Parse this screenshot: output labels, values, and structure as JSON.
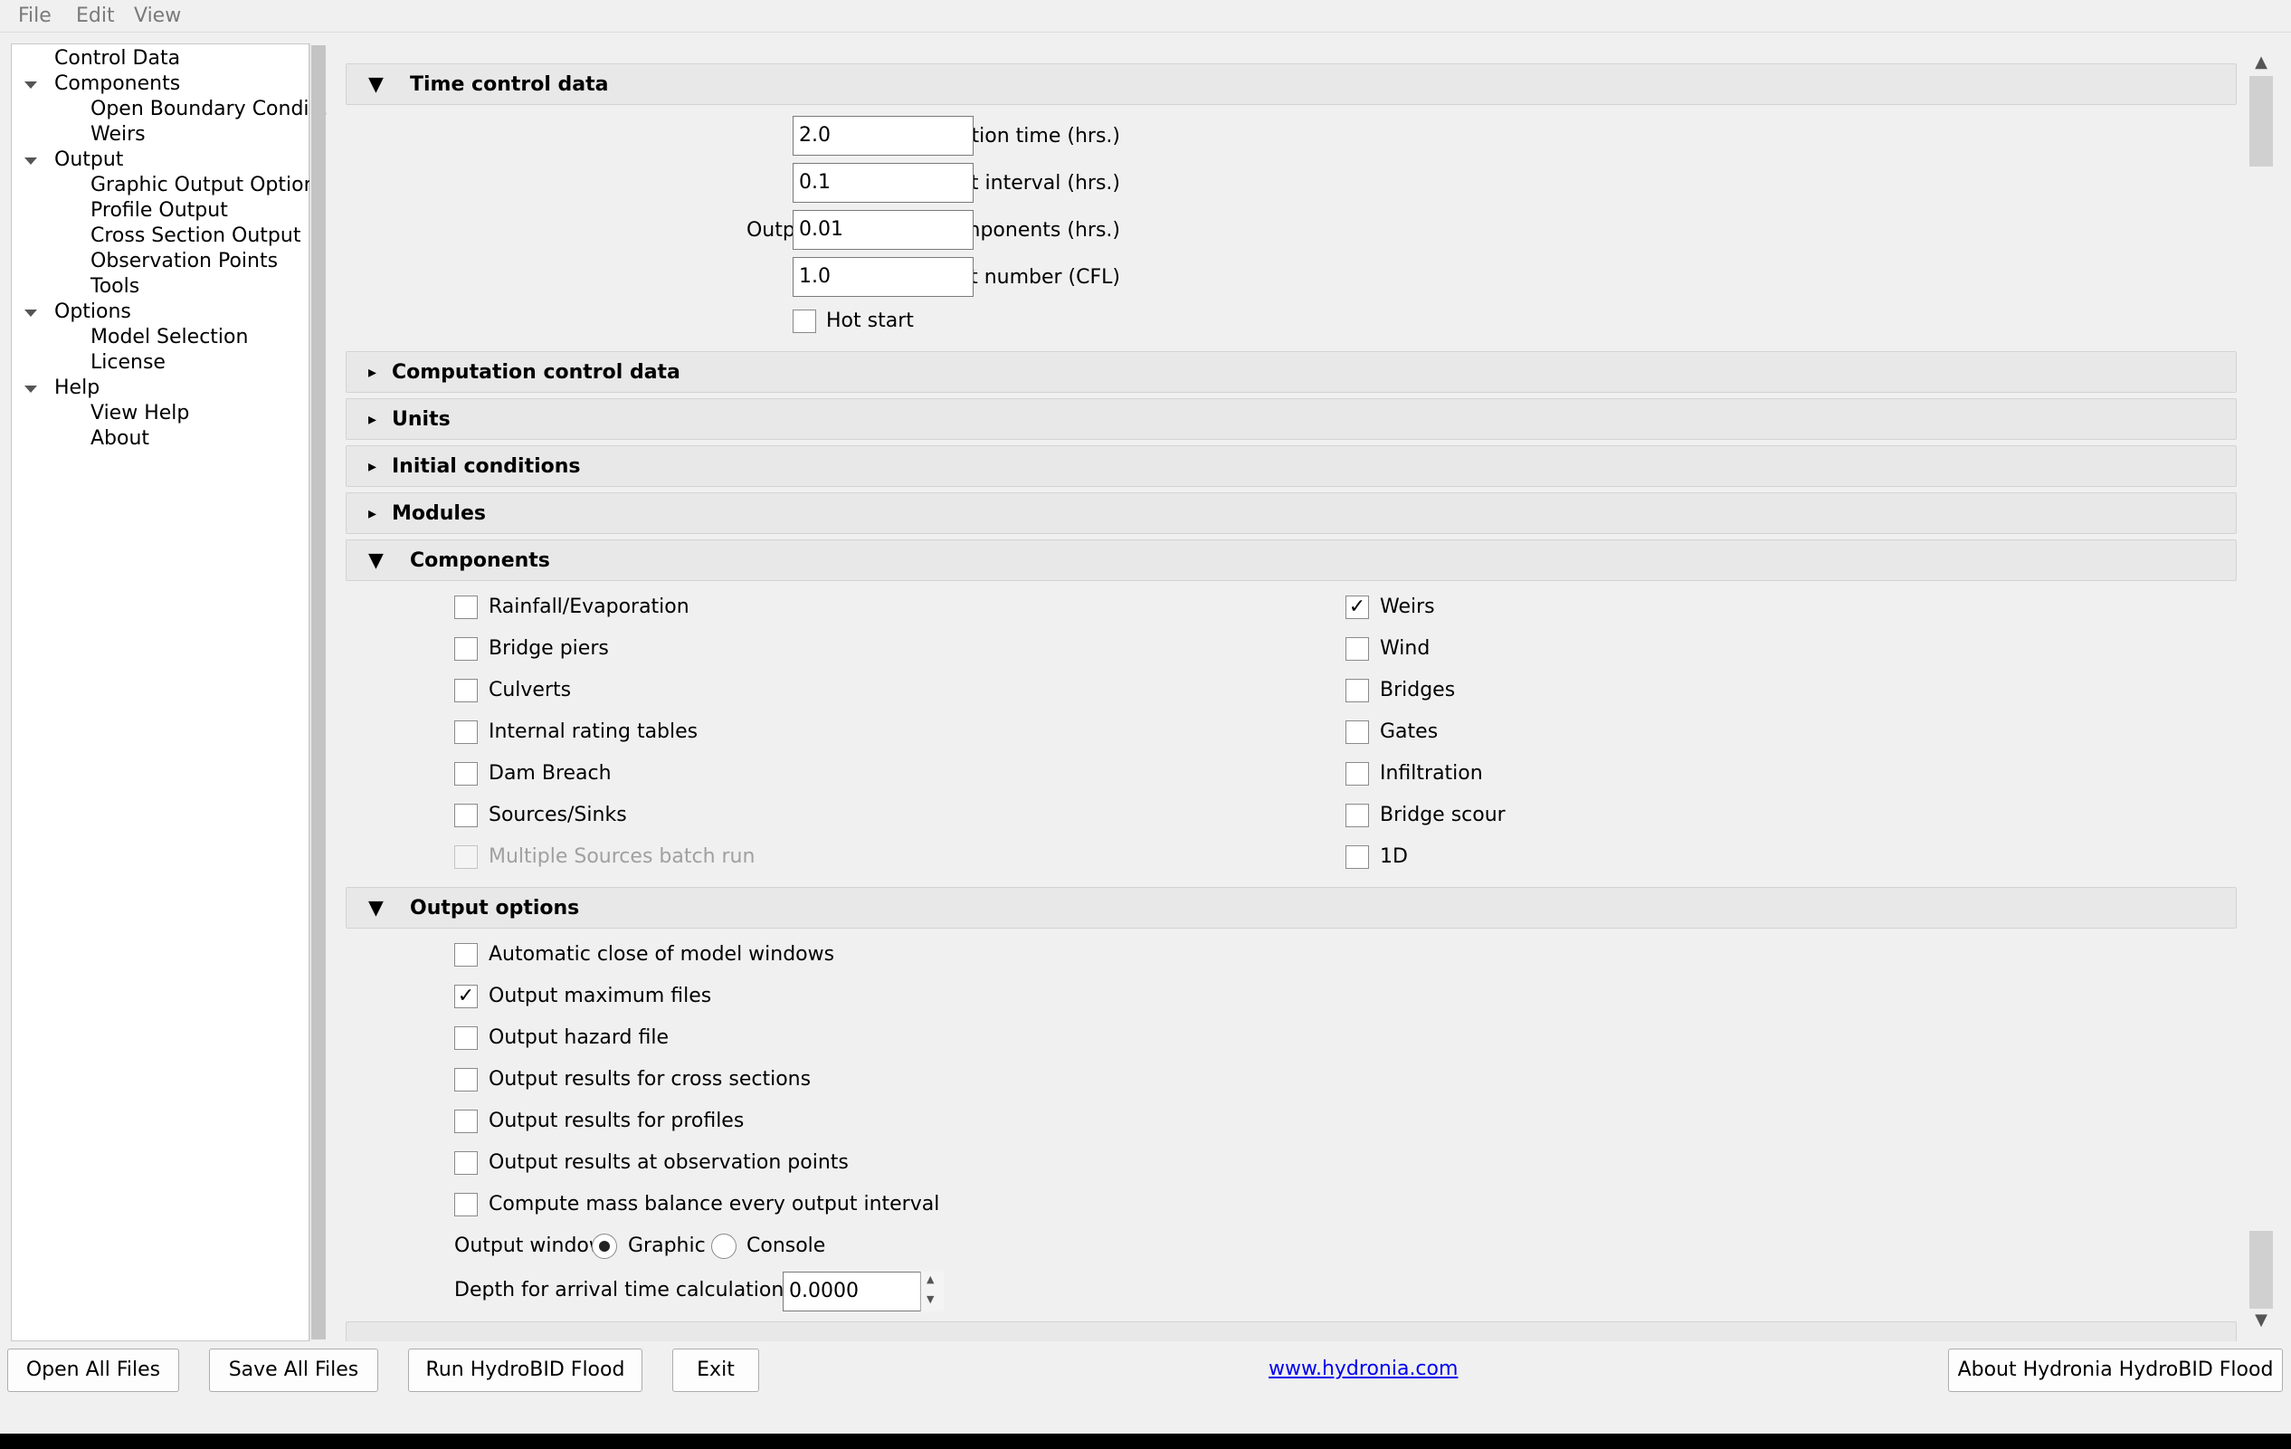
{
  "menu": {
    "file": "File",
    "edit": "Edit",
    "view": "View"
  },
  "sidebar": {
    "items": [
      {
        "label": "Control Data"
      },
      {
        "label": "Components"
      },
      {
        "label": "Open Boundary Condi..."
      },
      {
        "label": "Weirs"
      },
      {
        "label": "Output"
      },
      {
        "label": "Graphic Output Options"
      },
      {
        "label": "Profile Output"
      },
      {
        "label": "Cross Section Output"
      },
      {
        "label": "Observation Points"
      },
      {
        "label": "Tools"
      },
      {
        "label": "Options"
      },
      {
        "label": "Model Selection"
      },
      {
        "label": "License"
      },
      {
        "label": "Help"
      },
      {
        "label": "View Help"
      },
      {
        "label": "About"
      }
    ]
  },
  "sections": {
    "time_control": {
      "title": "Time control data",
      "simulation_time_label": "Simulation time (hrs.)",
      "simulation_time_value": "2.0",
      "output_interval_label": "Output interval (hrs.)",
      "output_interval_value": "0.1",
      "output_interval_components_label": "Output interval for components (hrs.)",
      "output_interval_components_value": "0.01",
      "courant_label": "Courant number (CFL)",
      "courant_value": "1.0",
      "hot_start_label": "Hot start",
      "hot_start_checked": false
    },
    "computation_control": {
      "title": "Computation control data"
    },
    "units": {
      "title": "Units"
    },
    "initial_conditions": {
      "title": "Initial conditions"
    },
    "modules": {
      "title": "Modules"
    },
    "components": {
      "title": "Components",
      "left": [
        {
          "label": "Rainfall/Evaporation",
          "checked": false,
          "enabled": true
        },
        {
          "label": "Bridge piers",
          "checked": false,
          "enabled": true
        },
        {
          "label": "Culverts",
          "checked": false,
          "enabled": true
        },
        {
          "label": "Internal rating tables",
          "checked": false,
          "enabled": true
        },
        {
          "label": "Dam Breach",
          "checked": false,
          "enabled": true
        },
        {
          "label": "Sources/Sinks",
          "checked": false,
          "enabled": true
        },
        {
          "label": "Multiple Sources batch run",
          "checked": false,
          "enabled": false
        }
      ],
      "right": [
        {
          "label": "Weirs",
          "checked": true,
          "enabled": true
        },
        {
          "label": "Wind",
          "checked": false,
          "enabled": true
        },
        {
          "label": "Bridges",
          "checked": false,
          "enabled": true
        },
        {
          "label": "Gates",
          "checked": false,
          "enabled": true
        },
        {
          "label": "Infiltration",
          "checked": false,
          "enabled": true
        },
        {
          "label": "Bridge scour",
          "checked": false,
          "enabled": true
        },
        {
          "label": "1D",
          "checked": false,
          "enabled": true
        }
      ]
    },
    "output_options": {
      "title": "Output options",
      "items": [
        {
          "label": "Automatic close of model windows",
          "checked": false
        },
        {
          "label": "Output maximum files",
          "checked": true
        },
        {
          "label": "Output hazard file",
          "checked": false
        },
        {
          "label": "Output results for cross sections",
          "checked": false
        },
        {
          "label": "Output results for profiles",
          "checked": false
        },
        {
          "label": "Output results at observation points",
          "checked": false
        },
        {
          "label": "Compute mass balance every output interval",
          "checked": false
        }
      ],
      "output_window_label": "Output window",
      "radio_graphic": "Graphic",
      "radio_console": "Console",
      "selected_window": "Graphic",
      "arrival_depth_label": "Depth for arrival time calculation (ft)",
      "arrival_depth_value": "0.0000"
    }
  },
  "checkmark_glyph": "✓",
  "footer": {
    "open_all": "Open All Files",
    "save_all": "Save All Files",
    "run": "Run HydroBID Flood",
    "exit": "Exit",
    "website": "www.hydronia.com",
    "about": "About Hydronia HydroBID Flood"
  },
  "icons": {
    "expanded_arrow": "▼",
    "collapsed_arrow": "▸",
    "scroll_up": "▲",
    "scroll_down": "▼",
    "spin_up": "▲",
    "spin_down": "▼"
  }
}
